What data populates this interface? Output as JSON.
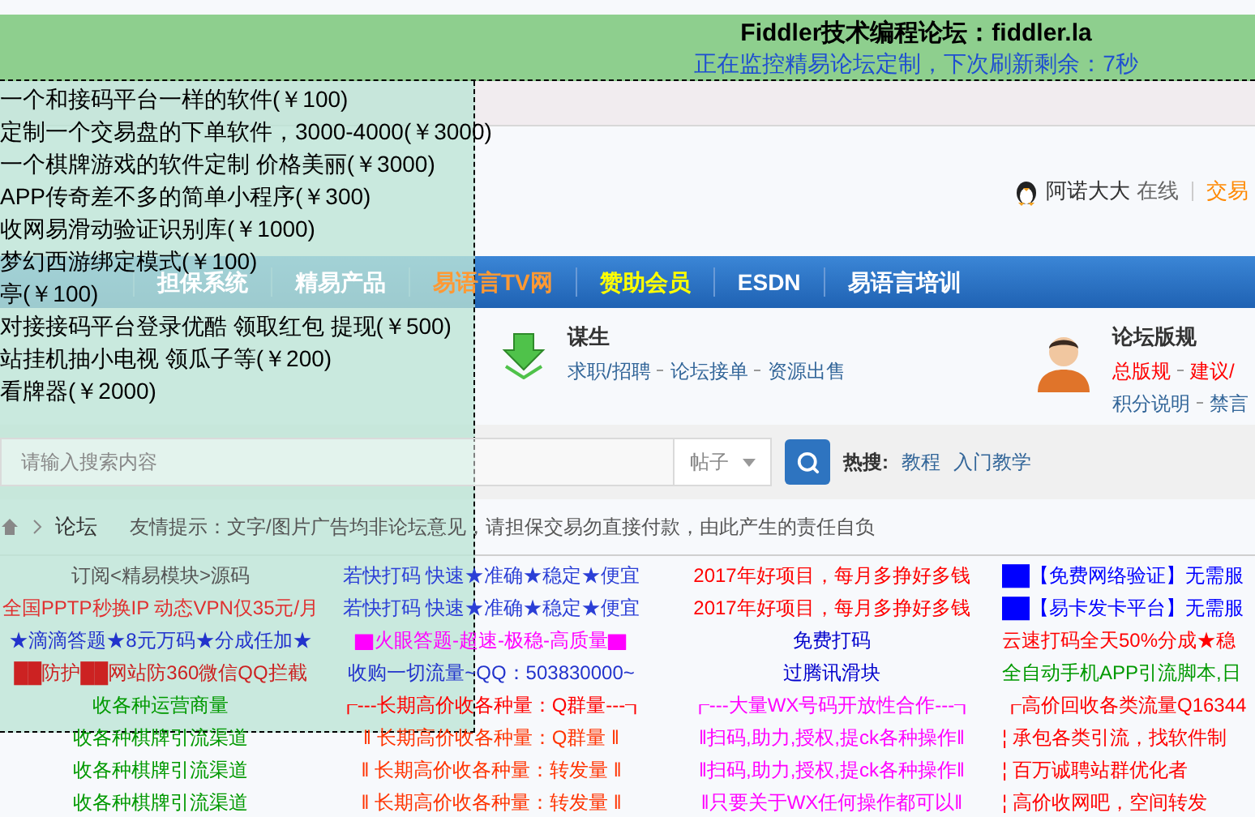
{
  "banner": {
    "title": "Fiddler技术编程论坛：fiddler.la",
    "status": "正在监控精易论坛定制，下次刷新剩余：7秒"
  },
  "user": {
    "name": "阿诺大大",
    "status": "在线",
    "link": "交易"
  },
  "nav": [
    {
      "label": "担保系统",
      "color": "#ffffff"
    },
    {
      "label": "精易产品",
      "color": "#ffffff"
    },
    {
      "label": "易语言TV网",
      "color": "#ff9933"
    },
    {
      "label": "赞助会员",
      "color": "#ffff00"
    },
    {
      "label": "ESDN",
      "color": "#ffffff"
    },
    {
      "label": "易语言培训",
      "color": "#ffffff"
    }
  ],
  "info": [
    {
      "kind": "download",
      "title": "谋生",
      "rows": [
        [
          {
            "label": "求职/招聘",
            "color": "#336699"
          },
          {
            "label": "论坛接单",
            "color": "#336699"
          },
          {
            "label": "资源出售",
            "color": "#336699"
          }
        ]
      ]
    },
    {
      "kind": "person",
      "title": "论坛版规",
      "rows": [
        [
          {
            "label": "总版规",
            "color": "#ff0000"
          },
          {
            "label": "建议/",
            "color": "#ff0000"
          }
        ],
        [
          {
            "label": "积分说明",
            "color": "#336699"
          },
          {
            "label": "禁言",
            "color": "#336699"
          }
        ]
      ]
    }
  ],
  "search": {
    "placeholder": "请输入搜索内容",
    "scope": "帖子",
    "hot_label": "热搜:",
    "hot_terms": [
      "教程",
      "入门教学"
    ]
  },
  "breadcrumb": {
    "current": "论坛",
    "notice": "友情提示：文字/图片广告均非论坛意见，请担保交易勿直接付款，由此产生的责任自负"
  },
  "ads": [
    [
      {
        "text": "订阅<精易模块>源码",
        "color": "#555555"
      },
      {
        "text": "若快打码 快速★准确★稳定★便宜",
        "color": "#2b3fd6"
      },
      {
        "text": "2017年好项目，每月多挣好多钱",
        "color": "#ff0000"
      },
      {
        "text": "██【免费网络验证】无需服",
        "color": "#0000ff"
      }
    ],
    [
      {
        "text": "全国PPTP秒换IP 动态VPN仅35元/月",
        "color": "#e03030"
      },
      {
        "text": "若快打码 快速★准确★稳定★便宜",
        "color": "#2b3fd6"
      },
      {
        "text": "2017年好项目，每月多挣好多钱",
        "color": "#ff0000"
      },
      {
        "text": "██【易卡发卡平台】无需服",
        "color": "#0000ff"
      }
    ],
    [
      {
        "text": "★滴滴答题★8元万码★分成任加★",
        "color": "#2233cc"
      },
      {
        "text": "▇火眼答题-超速-极稳-高质量▇",
        "color": "#ff00ff"
      },
      {
        "text": "免费打码",
        "color": "#0000cc"
      },
      {
        "text": "云速打码全天50%分成★稳",
        "color": "#ff0000"
      }
    ],
    [
      {
        "text": "██防护██网站防360微信QQ拦截",
        "color": "#cc2222"
      },
      {
        "text": "收购一切流量~QQ：503830000~",
        "color": "#2233cc"
      },
      {
        "text": "过腾讯滑块",
        "color": "#0000cc"
      },
      {
        "text": "全自动手机APP引流脚本,日",
        "color": "#009900"
      }
    ],
    [
      {
        "text": "收各种运营商量",
        "color": "#009900"
      },
      {
        "text": "┎---长期高价收各种量：Q群量---┒",
        "color": "#ff0000"
      },
      {
        "text": "┎---大量WX号码开放性合作---┒",
        "color": "#ff00ff"
      },
      {
        "text": "┎高价回收各类流量Q16344",
        "color": "#ff0000"
      }
    ],
    [
      {
        "text": "收各种棋牌引流渠道",
        "color": "#009900"
      },
      {
        "text": "‖ 长期高价收各种量：Q群量 ‖",
        "color": "#ff3300"
      },
      {
        "text": "‖扫码,助力,授权,提ck各种操作‖",
        "color": "#ff00ff"
      },
      {
        "text": "¦ 承包各类引流，找软件制",
        "color": "#ff0000"
      }
    ],
    [
      {
        "text": "收各种棋牌引流渠道",
        "color": "#009900"
      },
      {
        "text": "‖ 长期高价收各种量：转发量 ‖",
        "color": "#ff3300"
      },
      {
        "text": "‖扫码,助力,授权,提ck各种操作‖",
        "color": "#ff00ff"
      },
      {
        "text": "¦ 百万诚聘站群优化者",
        "color": "#ff0000"
      }
    ],
    [
      {
        "text": "收各种棋牌引流渠道",
        "color": "#009900"
      },
      {
        "text": "‖ 长期高价收各种量：转发量 ‖",
        "color": "#ff3300"
      },
      {
        "text": "‖只要关于WX任何操作都可以‖",
        "color": "#ff00ff"
      },
      {
        "text": "¦ 高价收网吧，空间转发",
        "color": "#ff0000"
      }
    ]
  ],
  "overlay": {
    "posts": [
      "一个和接码平台一样的软件(￥100)",
      "定制一个交易盘的下单软件，3000-4000(￥3000)",
      "一个棋牌游戏的软件定制 价格美丽(￥3000)",
      "APP传奇差不多的简单小程序(￥300)",
      "收网易滑动验证识别库(￥1000)",
      "梦幻西游绑定模式(￥100)",
      "亭(￥100)",
      "对接接码平台登录优酷 领取红包 提现(￥500)",
      "站挂机抽小电视 领瓜子等(￥200)",
      "看牌器(￥2000)"
    ]
  }
}
